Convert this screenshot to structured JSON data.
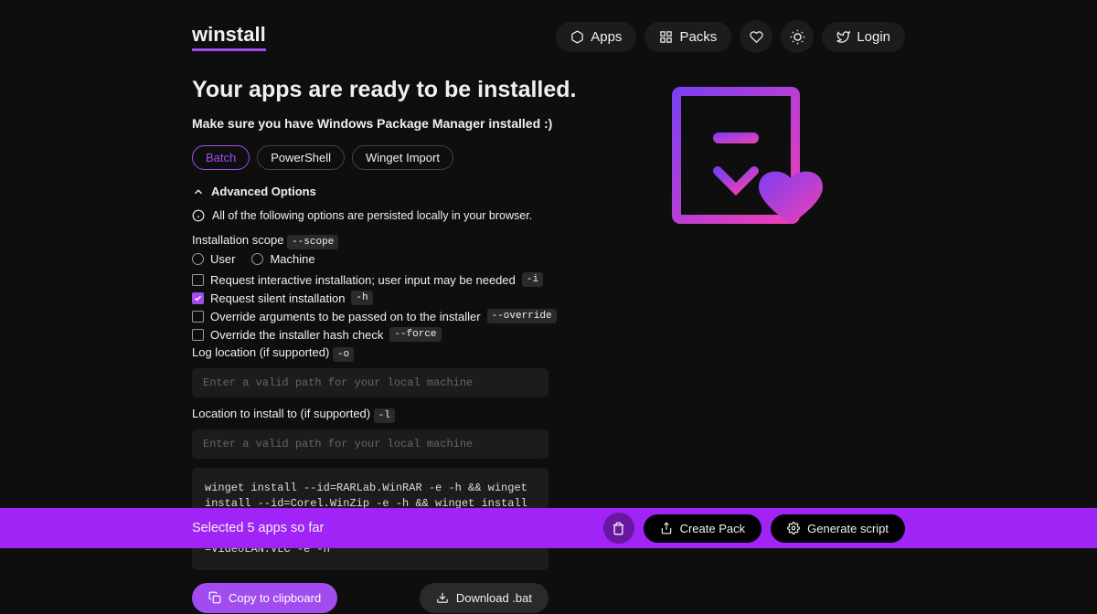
{
  "brand": "winstall",
  "nav": {
    "apps": "Apps",
    "packs": "Packs",
    "login": "Login"
  },
  "title": "Your apps are ready to be installed.",
  "subtitle": "Make sure you have Windows Package Manager installed :)",
  "tabs": {
    "batch": "Batch",
    "powershell": "PowerShell",
    "winget": "Winget Import"
  },
  "adv_toggle": "Advanced Options",
  "info_text": "All of the following options are persisted locally in your browser.",
  "scope_label": "Installation scope",
  "scope_flag": "--scope",
  "scope_user": "User",
  "scope_machine": "Machine",
  "check_interactive": "Request interactive installation; user input may be needed",
  "flag_i": "-i",
  "check_silent": "Request silent installation",
  "flag_h": "-h",
  "check_override": "Override arguments to be passed on to the installer",
  "flag_override": "--override",
  "check_force": "Override the installer hash check",
  "flag_force": "--force",
  "log_label": "Log location (if supported)",
  "flag_o": "-o",
  "install_loc_label": "Location to install to (if supported)",
  "flag_l": "-l",
  "path_placeholder": "Enter a valid path for your local machine",
  "script": "winget install --id=RARLab.WinRAR -e -h && winget install --id=Corel.WinZip -e -h && winget install --id=File-New-Project.EarTrumpet -e -h && winget install --id=flux.flux -e -h && winget install --id=VideoLAN.VLC -e -h",
  "copy_btn": "Copy to clipboard",
  "download_btn": "Download .bat",
  "bar_text": "Selected 5 apps so far",
  "create_pack": "Create Pack",
  "generate_script": "Generate script"
}
